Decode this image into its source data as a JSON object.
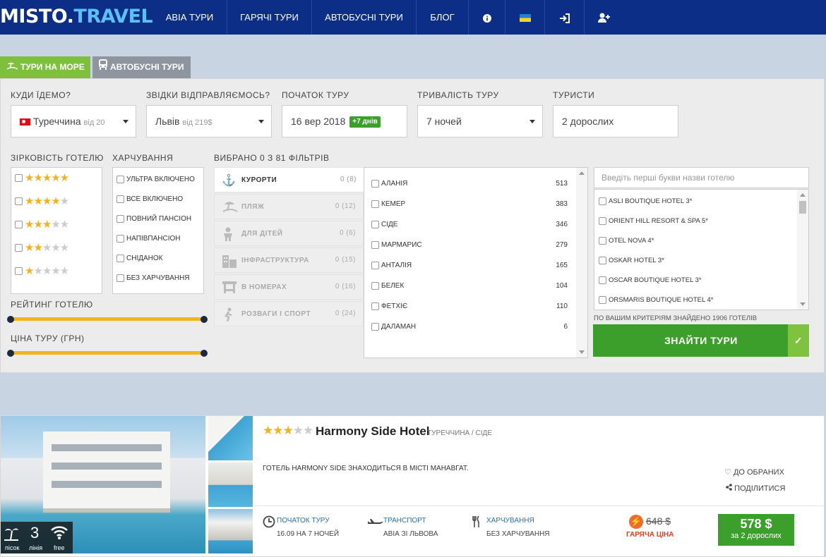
{
  "nav": {
    "logo_main": "MISTO",
    "logo_dot": ".",
    "logo_suffix": "TRAVEL",
    "items": [
      "АВІА ТУРИ",
      "ГАРЯЧІ ТУРИ",
      "АВТОБУСНІ ТУРИ",
      "БЛОГ"
    ],
    "icons": [
      "info-icon",
      "ukraine-flag-icon",
      "login-icon",
      "register-icon"
    ]
  },
  "tabs": {
    "sea": "ТУРИ НА МОРЕ",
    "bus": "АВТОБУСНІ ТУРИ"
  },
  "search": {
    "destination": {
      "label": "КУДИ ЇДЕМО?",
      "value": "Туреччина",
      "price": "від 20"
    },
    "departure": {
      "label": "ЗВІДКИ ВІДПРАВЛЯЄМОСЬ?",
      "value": "Львів",
      "price": "від 219$"
    },
    "start": {
      "label": "ПОЧАТОК ТУРУ",
      "value": "16 вер 2018",
      "badge": "+7 днів"
    },
    "duration": {
      "label": "ТРИВАЛІСТЬ ТУРУ",
      "value": "7 ночей"
    },
    "tourists": {
      "label": "ТУРИСТИ",
      "value": "2 дорослих"
    }
  },
  "filters": {
    "stars_label": "ЗІРКОВІСТЬ ГОТЕЛЮ",
    "star_levels": [
      5,
      4,
      3,
      2,
      1
    ],
    "food_label": "ХАРЧУВАННЯ",
    "food": [
      "УЛЬТРА ВКЛЮЧЕНО",
      "ВСЕ ВКЛЮЧЕНО",
      "ПОВНИЙ ПАНСІОН",
      "НАПІВПАНСІОН",
      "СНІДАНОК",
      "БЕЗ ХАРЧУВАННЯ"
    ],
    "rating_label": "РЕЙТИНГ ГОТЕЛЮ",
    "price_label": "ЦІНА ТУРУ (ГРН)",
    "selected_label": "ВИБРАНО 0 З 81 ФІЛЬТРІВ",
    "categories": [
      {
        "name": "КУРОРТИ",
        "count": "0 (8)",
        "icon": "anchor-icon"
      },
      {
        "name": "ПЛЯЖ",
        "count": "0 (12)",
        "icon": "beach-icon"
      },
      {
        "name": "ДЛЯ ДІТЕЙ",
        "count": "0 (6)",
        "icon": "child-icon"
      },
      {
        "name": "ІНФРАСТРУКТУРА",
        "count": "0 (15)",
        "icon": "building-icon"
      },
      {
        "name": "В НОМЕРАХ",
        "count": "0 (16)",
        "icon": "room-icon"
      },
      {
        "name": "РОЗВАГИ І СПОРТ",
        "count": "0 (24)",
        "icon": "sport-icon"
      }
    ],
    "resorts": [
      {
        "name": "АЛАНІЯ",
        "count": "513"
      },
      {
        "name": "КЕМЕР",
        "count": "383"
      },
      {
        "name": "СІДЕ",
        "count": "346"
      },
      {
        "name": "МАРМАРИС",
        "count": "279"
      },
      {
        "name": "АНТАЛІЯ",
        "count": "165"
      },
      {
        "name": "БЕЛЕК",
        "count": "104"
      },
      {
        "name": "ФЕТХІЄ",
        "count": "110"
      },
      {
        "name": "ДАЛАМАН",
        "count": "6"
      }
    ],
    "hotel_placeholder": "Введіть перші букви назви готелю",
    "hotels": [
      "ASLI BOUTIQUE HOTEL 3*",
      "ORIENT HILL RESORT & SPA 5*",
      "OTEL NOVA 4*",
      "OSKAR HOTEL 3*",
      "OSCAR BOUTIQUE HOTEL 3*",
      "ORSMARIS BOUTIQUE HOTEL 4*"
    ],
    "found": "ПО ВАШИМ КРИТЕРІЯМ ЗНАЙДЕНО 1906 ГОТЕЛІВ",
    "find_button": "ЗНАЙТИ ТУРИ"
  },
  "hotel": {
    "stars": 3,
    "name": "Harmony Side Hotel",
    "location": "ТУРЕЧЧИНА / СІДЕ",
    "description": "ГОТЕЛЬ HARMONY SIDE ЗНАХОДИТЬСЯ В МІСТІ МАНАВГАТ.",
    "favorite": "ДО ОБРАНИХ",
    "share": "ПОДІЛИТИСЯ",
    "start_label": "ПОЧАТОК ТУРУ",
    "start_value": "16.09 НА 7 НОЧЕЙ",
    "transport_label": "ТРАНСПОРТ",
    "transport_value": "АВІА ЗІ ЛЬВОВА",
    "food_label": "ХАРЧУВАННЯ",
    "food_value": "БЕЗ ХАРЧУВАННЯ",
    "old_price": "648 $",
    "hot_label": "ГАРЯЧА ЦІНА",
    "price": "578 $",
    "price_note": "за 2 дорослих",
    "badge_beach": "пісок",
    "badge_line": "3",
    "badge_line_label": "лінія",
    "badge_wifi": "free"
  }
}
